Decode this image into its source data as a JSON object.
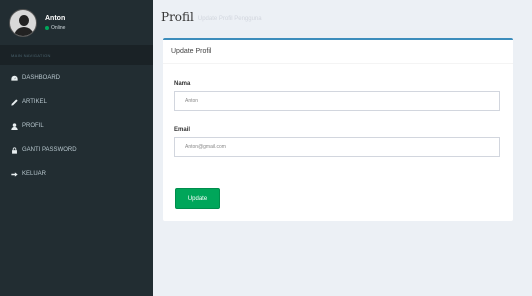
{
  "sidebar": {
    "user": {
      "name": "Anton",
      "status": "Online"
    },
    "nav_header": "MAIN NAVIGATION",
    "items": [
      {
        "label": "DASHBOARD",
        "icon": "dashboard-icon"
      },
      {
        "label": "ARTIKEL",
        "icon": "pencil-icon"
      },
      {
        "label": "PROFIL",
        "icon": "user-icon"
      },
      {
        "label": "GANTI PASSWORD",
        "icon": "lock-icon"
      },
      {
        "label": "KELUAR",
        "icon": "sign-out-icon"
      }
    ]
  },
  "header": {
    "title": "Profil",
    "subtitle": "Update Profil Pengguna"
  },
  "form": {
    "title": "Update Profil",
    "name_label": "Nama",
    "name_value": "Anton",
    "email_label": "Email",
    "email_value": "Anton@gmail.com",
    "submit_label": "Update"
  },
  "colors": {
    "sidebar_bg": "#222d32",
    "content_bg": "#ecf0f5",
    "box_accent": "#3c8dbc",
    "button": "#00a65a"
  }
}
